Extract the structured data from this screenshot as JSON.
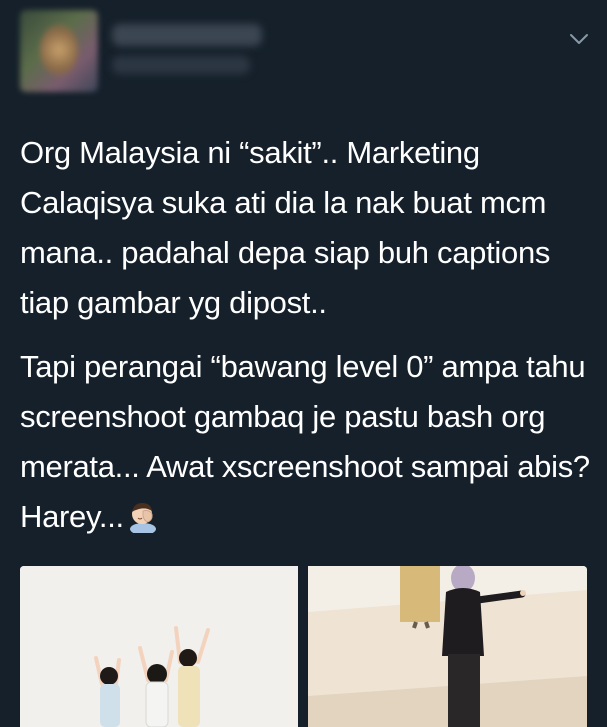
{
  "tweet": {
    "paragraphs": [
      "Org Malaysia ni “sakit”.. Marketing Calaqisya suka ati dia la nak buat mcm mana.. padahal depa siap buh captions tiap gambar yg dipost..",
      "Tapi perangai “bawang level 0” ampa tahu screenshoot gambaq je pastu bash org merata... Awat xscreenshoot sampai abis? Harey..."
    ],
    "emoji": "man-facepalming-icon"
  },
  "icons": {
    "menu": "chevron-down-icon"
  },
  "colors": {
    "background": "#15202b",
    "text": "#ffffff",
    "chevron": "#8899a6"
  }
}
